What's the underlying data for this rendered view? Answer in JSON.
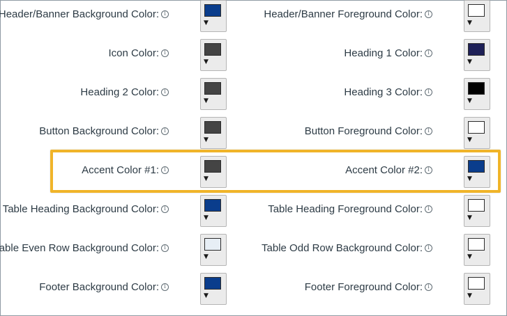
{
  "rows": [
    {
      "left": {
        "label": "Header/Banner Background Color:",
        "color": "#0a3d8c"
      },
      "right": {
        "label": "Header/Banner Foreground Color:",
        "color": "#ffffff"
      }
    },
    {
      "left": {
        "label": "Icon Color:",
        "color": "#444444"
      },
      "right": {
        "label": "Heading 1 Color:",
        "color": "#1e2057"
      }
    },
    {
      "left": {
        "label": "Heading 2 Color:",
        "color": "#444444"
      },
      "right": {
        "label": "Heading 3 Color:",
        "color": "#000000"
      }
    },
    {
      "left": {
        "label": "Button Background Color:",
        "color": "#444444"
      },
      "right": {
        "label": "Button Foreground Color:",
        "color": "#ffffff"
      }
    },
    {
      "left": {
        "label": "Accent Color #1:",
        "color": "#444444"
      },
      "right": {
        "label": "Accent Color #2:",
        "color": "#0a3d8c"
      }
    },
    {
      "left": {
        "label": "Table Heading Background Color:",
        "color": "#0a3d8c"
      },
      "right": {
        "label": "Table Heading Foreground Color:",
        "color": "#ffffff"
      }
    },
    {
      "left": {
        "label": "Table Even Row Background Color:",
        "color": "#e7eef5"
      },
      "right": {
        "label": "Table Odd Row Background Color:",
        "color": "#ffffff"
      }
    },
    {
      "left": {
        "label": "Footer Background Color:",
        "color": "#0a3d8c"
      },
      "right": {
        "label": "Footer Foreground Color:",
        "color": "#ffffff"
      }
    }
  ],
  "info_icon_glyph": "i",
  "dropdown_caret_glyph": "▼",
  "highlight_color": "#f0b429",
  "highlighted_row": 4
}
